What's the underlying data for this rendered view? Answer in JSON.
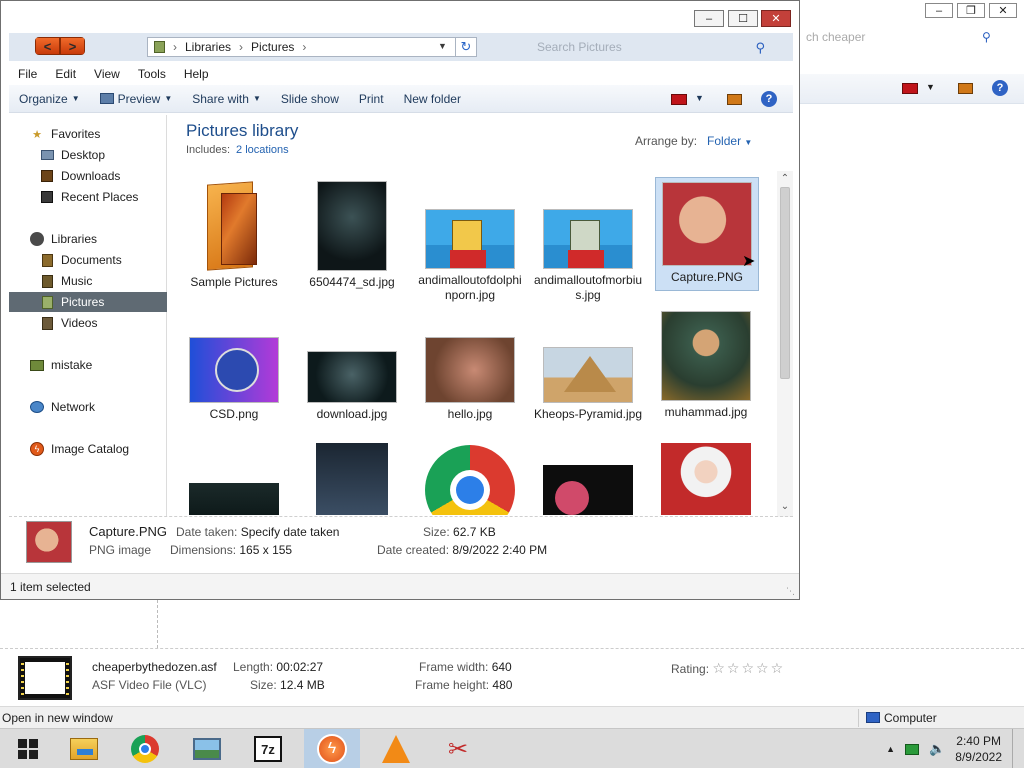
{
  "background_window": {
    "search_placeholder": "ch cheaper",
    "details": {
      "file_name": "cheaperbythedozen.asf",
      "file_type": "ASF Video File (VLC)",
      "length_label": "Length:",
      "length_value": "00:02:27",
      "size_label": "Size:",
      "size_value": "12.4 MB",
      "frame_width_label": "Frame width:",
      "frame_width_value": "640",
      "frame_height_label": "Frame height:",
      "frame_height_value": "480",
      "rating_label": "Rating:",
      "rating_stars": "☆☆☆☆☆"
    },
    "status": {
      "left": "Open in new window",
      "right": "Computer"
    }
  },
  "window": {
    "address": {
      "segments": [
        "Libraries",
        "Pictures"
      ],
      "search_placeholder": "Search Pictures"
    },
    "menu": [
      "File",
      "Edit",
      "View",
      "Tools",
      "Help"
    ],
    "toolbar": {
      "organize": "Organize",
      "preview": "Preview",
      "share_with": "Share with",
      "slide_show": "Slide show",
      "print": "Print",
      "new_folder": "New folder"
    },
    "nav": {
      "favorites": "Favorites",
      "desktop": "Desktop",
      "downloads": "Downloads",
      "recent_places": "Recent Places",
      "libraries": "Libraries",
      "documents": "Documents",
      "music": "Music",
      "pictures": "Pictures",
      "videos": "Videos",
      "mistake": "mistake",
      "network": "Network",
      "image_catalog": "Image Catalog"
    },
    "content": {
      "title": "Pictures library",
      "includes_label": "Includes:",
      "includes_link": "2 locations",
      "arrange_label": "Arrange by:",
      "arrange_value": "Folder",
      "items": [
        {
          "name": "Sample Pictures"
        },
        {
          "name": "6504474_sd.jpg"
        },
        {
          "name": "andimalloutofdolphinporn.jpg"
        },
        {
          "name": "andimalloutofmorbius.jpg"
        },
        {
          "name": "Capture.PNG"
        },
        {
          "name": "CSD.png"
        },
        {
          "name": "download.jpg"
        },
        {
          "name": "hello.jpg"
        },
        {
          "name": "Kheops-Pyramid.jpg"
        },
        {
          "name": "muhammad.jpg"
        }
      ]
    },
    "details": {
      "file_name": "Capture.PNG",
      "file_type": "PNG image",
      "date_taken_label": "Date taken:",
      "date_taken_value": "Specify date taken",
      "dimensions_label": "Dimensions:",
      "dimensions_value": "165 x 155",
      "size_label": "Size:",
      "size_value": "62.7 KB",
      "date_created_label": "Date created:",
      "date_created_value": "8/9/2022 2:40 PM"
    },
    "status": "1 item selected"
  },
  "taskbar": {
    "time": "2:40 PM",
    "date": "8/9/2022"
  }
}
